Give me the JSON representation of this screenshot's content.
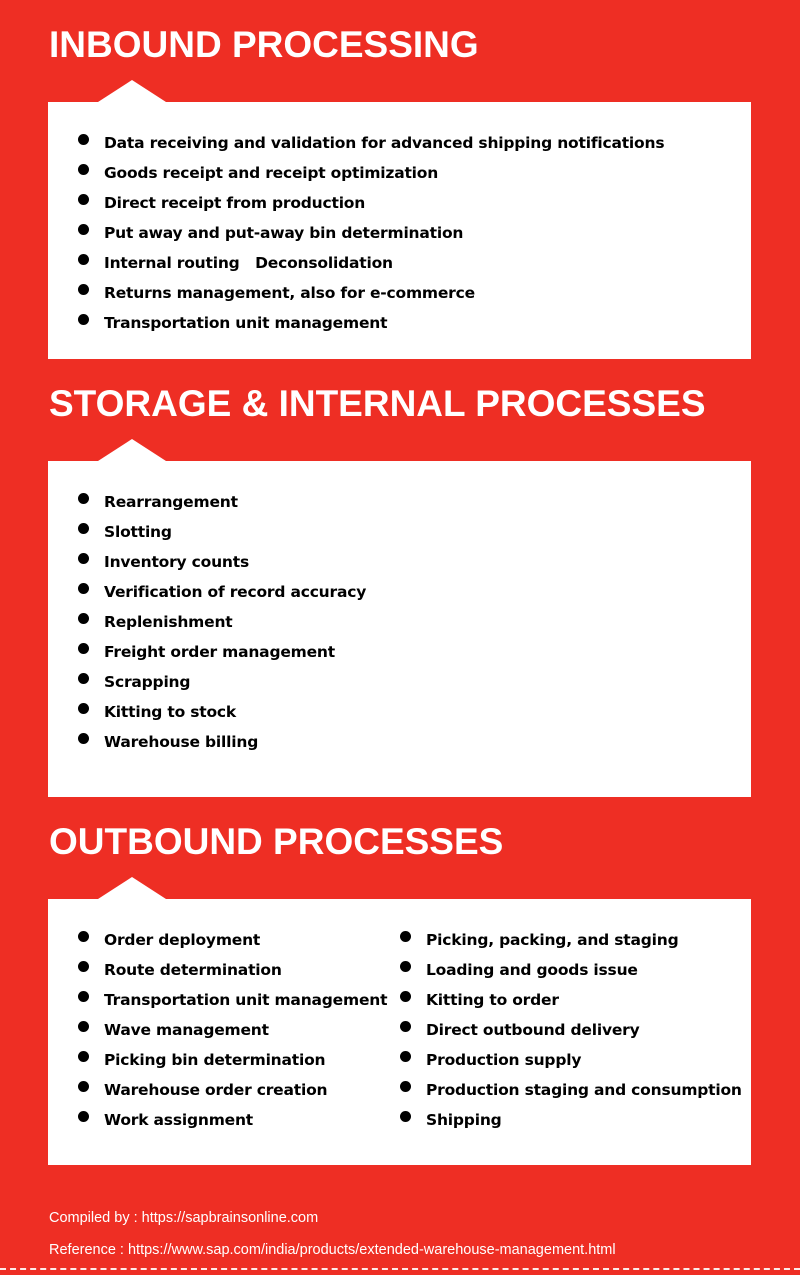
{
  "sections": [
    {
      "title": "INBOUND PROCESSING",
      "items": [
        "Data receiving and validation for advanced shipping notifications",
        "Goods receipt and receipt optimization",
        "Direct receipt from production",
        "Put away and put-away bin determination",
        "Internal routing   Deconsolidation",
        "Returns management, also for e-commerce",
        "Transportation unit management"
      ]
    },
    {
      "title": "STORAGE & INTERNAL PROCESSES",
      "items": [
        "Rearrangement",
        "Slotting",
        "Inventory counts",
        "Verification of record accuracy",
        "Replenishment",
        "Freight order management",
        "Scrapping",
        "Kitting to stock",
        "Warehouse billing"
      ]
    },
    {
      "title": "OUTBOUND PROCESSES",
      "items_left": [
        "Order deployment",
        "Route determination",
        "Transportation unit management",
        "Wave management",
        "Picking bin determination",
        "Warehouse order creation",
        "Work assignment"
      ],
      "items_right": [
        "Picking, packing, and staging",
        "Loading and goods issue",
        "Kitting to order",
        "Direct outbound delivery",
        "Production supply",
        "Production staging and consumption",
        "Shipping"
      ]
    }
  ],
  "footer": {
    "compiled_by": "Compiled by : https://sapbrainsonline.com",
    "reference": "Reference : https://www.sap.com/india/products/extended-warehouse-management.html"
  },
  "colors": {
    "background": "#ee2e24",
    "card": "#ffffff",
    "text": "#000000"
  }
}
